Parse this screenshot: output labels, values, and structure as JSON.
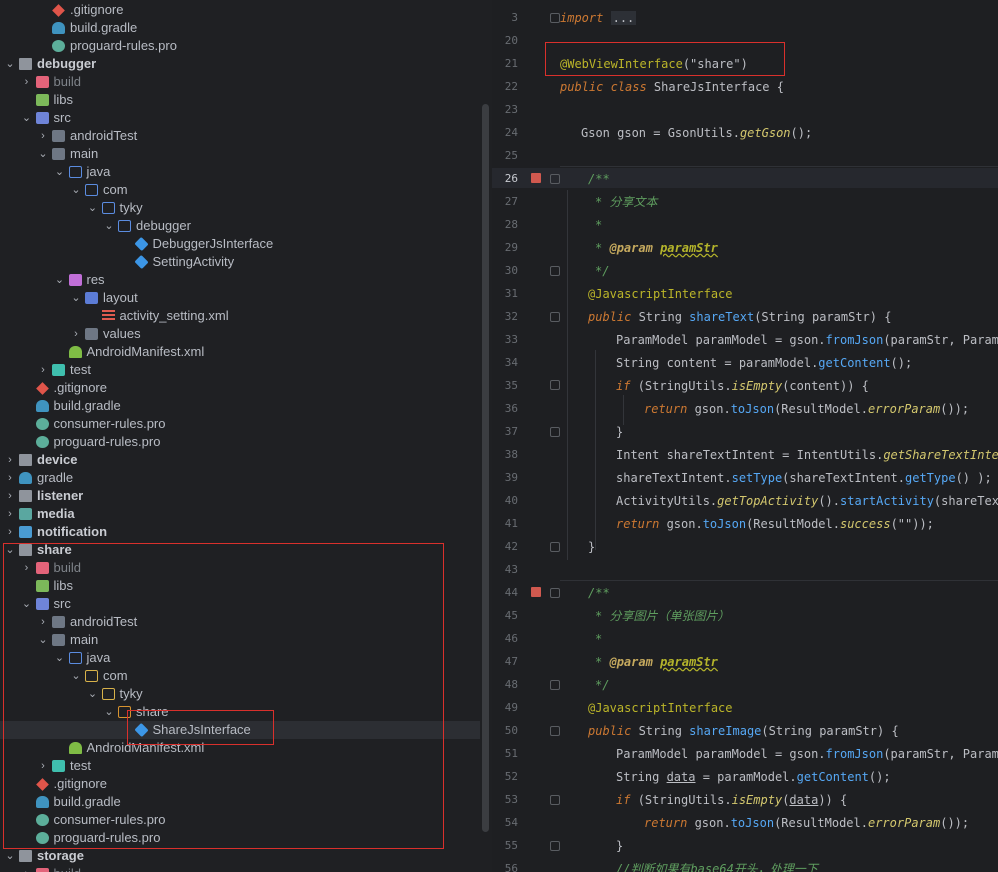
{
  "tree": {
    "items": [
      {
        "label": ".gitignore"
      },
      {
        "label": "build.gradle"
      },
      {
        "label": "proguard-rules.pro"
      },
      {
        "label": "debugger"
      },
      {
        "label": "build"
      },
      {
        "label": "libs"
      },
      {
        "label": "src"
      },
      {
        "label": "androidTest"
      },
      {
        "label": "main"
      },
      {
        "label": "java"
      },
      {
        "label": "com"
      },
      {
        "label": "tyky"
      },
      {
        "label": "debugger"
      },
      {
        "label": "DebuggerJsInterface"
      },
      {
        "label": "SettingActivity"
      },
      {
        "label": "res"
      },
      {
        "label": "layout"
      },
      {
        "label": "activity_setting.xml"
      },
      {
        "label": "values"
      },
      {
        "label": "AndroidManifest.xml"
      },
      {
        "label": "test"
      },
      {
        "label": ".gitignore"
      },
      {
        "label": "build.gradle"
      },
      {
        "label": "consumer-rules.pro"
      },
      {
        "label": "proguard-rules.pro"
      },
      {
        "label": "device"
      },
      {
        "label": "gradle"
      },
      {
        "label": "listener"
      },
      {
        "label": "media"
      },
      {
        "label": "notification"
      },
      {
        "label": "share"
      },
      {
        "label": "build"
      },
      {
        "label": "libs"
      },
      {
        "label": "src"
      },
      {
        "label": "androidTest"
      },
      {
        "label": "main"
      },
      {
        "label": "java"
      },
      {
        "label": "com"
      },
      {
        "label": "tyky"
      },
      {
        "label": "share"
      },
      {
        "label": "ShareJsInterface"
      },
      {
        "label": "AndroidManifest.xml"
      },
      {
        "label": "test"
      },
      {
        "label": ".gitignore"
      },
      {
        "label": "build.gradle"
      },
      {
        "label": "consumer-rules.pro"
      },
      {
        "label": "proguard-rules.pro"
      },
      {
        "label": "storage"
      },
      {
        "label": "build"
      }
    ]
  },
  "editor": {
    "line_numbers": [
      "3",
      "20",
      "21",
      "22",
      "23",
      "24",
      "25",
      "26",
      "27",
      "28",
      "29",
      "30",
      "31",
      "32",
      "33",
      "34",
      "35",
      "36",
      "37",
      "38",
      "39",
      "40",
      "41",
      "42",
      "43",
      "44",
      "45",
      "46",
      "47",
      "48",
      "49",
      "50",
      "51",
      "52",
      "53",
      "54",
      "55",
      "56"
    ],
    "import_kw": "import",
    "import_fold": "...",
    "annotation": "@WebViewInterface",
    "annotation_arg": "(\"share\")",
    "l22_a": "public class ",
    "l22_b": "ShareJsInterface {",
    "l24_a": "Gson gson = GsonUtils.",
    "l24_b": "getGson",
    "l24_c": "();",
    "doc_open": "/**",
    "doc_star": "*",
    "doc_close": "*/",
    "doc1_text": "分享文本",
    "doc_param_tag": "@param",
    "doc_param_name": "paramStr",
    "js_annotation": "@JavascriptInterface",
    "l32_a": "public ",
    "l32_b": "String ",
    "l32_c": "shareText",
    "l32_d": "(String paramStr) {",
    "l33_a": "ParamModel paramModel = gson.",
    "l33_b": "fromJson",
    "l33_c": "(paramStr, ParamMo",
    "l34_a": "String content = paramModel.",
    "l34_b": "getContent",
    "l34_c": "();",
    "l35_a": "if ",
    "l35_b": "(StringUtils.",
    "l35_c": "isEmpty",
    "l35_d": "(content)) {",
    "l36_a": "return ",
    "l36_b": "gson.",
    "l36_c": "toJson",
    "l36_d": "(ResultModel.",
    "l36_e": "errorParam",
    "l36_f": "());",
    "close_brace": "}",
    "l38_a": "Intent shareTextIntent = IntentUtils.",
    "l38_b": "getShareTextIntent",
    "l39_a": "shareTextIntent.",
    "l39_b": "setType",
    "l39_c": "(shareTextIntent.",
    "l39_d": "getType",
    "l39_e": "() );",
    "l40_a": "ActivityUtils.",
    "l40_b": "getTopActivity",
    "l40_c": "().",
    "l40_d": "startActivity",
    "l40_e": "(shareTextI",
    "l41_d": "(ResultModel.",
    "l41_e": "success",
    "l41_f": "(\"\"));",
    "doc2_text": "分享图片（单张图片）",
    "l50_c": "shareImage",
    "l52_a": "String ",
    "l52_b": "data",
    "l52_c": " = paramModel.",
    "l52_d": "getContent",
    "l52_e": "();",
    "l53_d": "(",
    "l53_e": "data",
    "l53_f": ")) {",
    "l56_text": "//判断如果有base64开头，处理一下"
  }
}
